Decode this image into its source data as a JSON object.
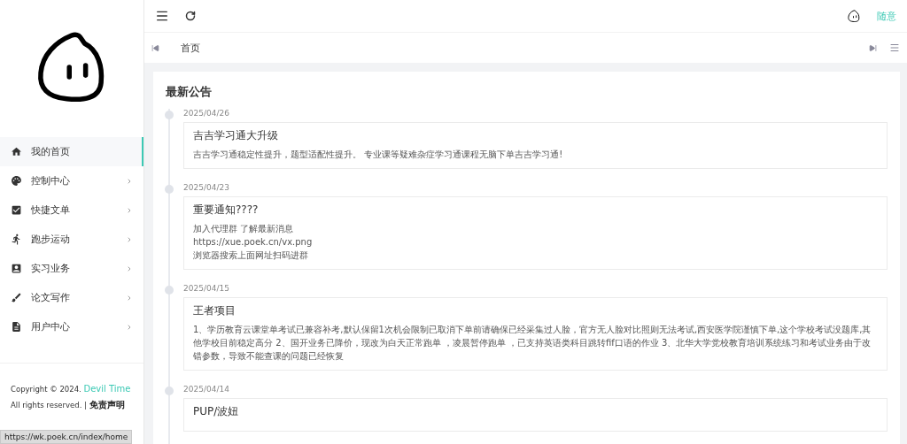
{
  "sidebar": {
    "items": [
      {
        "label": "我的首页",
        "selected": true,
        "has_submenu": false
      },
      {
        "label": "控制中心",
        "selected": false,
        "has_submenu": true
      },
      {
        "label": "快捷文单",
        "selected": false,
        "has_submenu": true
      },
      {
        "label": "跑步运动",
        "selected": false,
        "has_submenu": true
      },
      {
        "label": "实习业务",
        "selected": false,
        "has_submenu": true
      },
      {
        "label": "论文写作",
        "selected": false,
        "has_submenu": true
      },
      {
        "label": "用户中心",
        "selected": false,
        "has_submenu": true
      }
    ],
    "footer": {
      "copyright": "Copyright © 2024.",
      "brand_link": "Devil Time",
      "rights": "All rights reserved. |",
      "disclaimer_link": "免责声明"
    }
  },
  "header": {
    "username": "随意"
  },
  "tabs": [
    {
      "label": "首页",
      "selected": true
    }
  ],
  "announcements": {
    "title": "最新公告",
    "items": [
      {
        "date": "2025/04/26",
        "title": "吉吉学习通大升级",
        "lines": [
          "吉吉学习通稳定性提升，题型适配性提升。 专业课等疑难杂症学习通课程无脑下单吉吉学习通!"
        ]
      },
      {
        "date": "2025/04/23",
        "title": "重要通知????",
        "lines": [
          "加入代理群 了解最新消息",
          "https://xue.poek.cn/vx.png",
          "浏览器搜索上面网址扫码进群"
        ]
      },
      {
        "date": "2025/04/15",
        "title": "王者项目",
        "lines": [
          "1、学历教育云课堂单考试已兼容补考,默认保留1次机会限制已取消下单前请确保已经采集过人脸，官方无人脸对比照则无法考试,西安医学院谨慎下单,这个学校考试没题库,其他学校目前稳定高分 2、国开业务已降价，现改为白天正常跑单 ，凌晨暂停跑单 ，已支持英语类科目跳转fif口语的作业 3、北华大学党校教育培训系统练习和考试业务由于改错参数，导致不能查课的问题已经恢复"
        ]
      },
      {
        "date": "2025/04/14",
        "title": "PUP/波妞"
      }
    ]
  },
  "status_url": "https://wk.poek.cn/index/home"
}
